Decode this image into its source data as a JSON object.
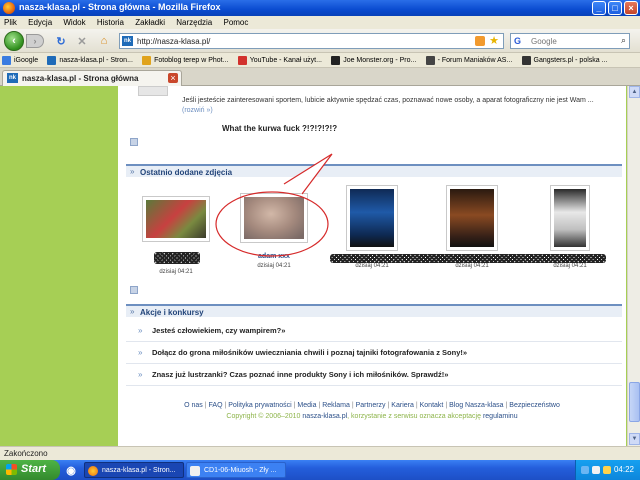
{
  "window": {
    "title": "nasza-klasa.pl - Strona główna - Mozilla Firefox"
  },
  "menu": [
    "Plik",
    "Edycja",
    "Widok",
    "Historia",
    "Zakładki",
    "Narzędzia",
    "Pomoc"
  ],
  "nav": {
    "url": "http://nasza-klasa.pl/",
    "favicon_text": "nk",
    "search_placeholder": "Google",
    "search_engine_glyph": "G"
  },
  "bookmarks": [
    {
      "label": "iGoogle",
      "color": "#3a7be0"
    },
    {
      "label": "nasza-klasa.pl - Stron...",
      "color": "#1f6bb8"
    },
    {
      "label": "Fotoblog terep w Phot...",
      "color": "#e0a31c"
    },
    {
      "label": "YouTube - Kanał użyt...",
      "color": "#d2322d"
    },
    {
      "label": "Joe Monster.org - Pro...",
      "color": "#222222"
    },
    {
      "label": "- Forum Maniaków AS...",
      "color": "#444444"
    },
    {
      "label": "Gangsters.pl - polska ...",
      "color": "#333333"
    }
  ],
  "tab": {
    "label": "nasza-klasa.pl - Strona główna"
  },
  "content": {
    "sport_text": "Jeśli jesteście zainteresowani sportem, lubicie aktywnie spędzać czas, poznawać nowe osoby, a aparat fotograficzny nie jest Wam ...",
    "sport_more": "(rozwiń »)",
    "what_text": "What the kurwa fuck ?!?!?!?!?",
    "recent_photos_title": "Ostatnio dodane zdjęcia",
    "photos": [
      {
        "name": "",
        "date": "dzisiaj 04:21"
      },
      {
        "name": "adam xxx",
        "date": "dzisiaj 04:21"
      },
      {
        "name": "",
        "date": "dzisiaj 04:21"
      },
      {
        "name": "",
        "date": "dzisiaj 04:21"
      },
      {
        "name": "",
        "date": "dzisiaj 04:21"
      }
    ],
    "contests_title": "Akcje i konkursy",
    "contests": [
      "Jesteś człowiekiem, czy wampirem?»",
      "Dołącz do grona miłośników uwieczniania chwili i poznaj tajniki fotografowania z Sony!»",
      "Znasz już lustrzanki? Czas poznać inne produkty Sony i ich miłośników. Sprawdź!»"
    ],
    "footer_links": [
      "O nas",
      "FAQ",
      "Polityka prywatności",
      "Media",
      "Reklama",
      "Partnerzy",
      "Kariera",
      "Kontakt",
      "Blog Nasza-klasa",
      "Bezpieczeństwo"
    ],
    "footer_copy_prefix": "Copyright © 2006–2010",
    "footer_copy_site": "nasza-klasa.pl",
    "footer_copy_suffix": ", korzystanie z serwisu oznacza akceptację",
    "footer_copy_link": "regulaminu"
  },
  "status": {
    "text": "Zakończono"
  },
  "taskbar": {
    "start": "Start",
    "items": [
      "nasza-klasa.pl - Stron...",
      "CD1-06-Miuosh - Zły ..."
    ],
    "clock": "04:22"
  }
}
